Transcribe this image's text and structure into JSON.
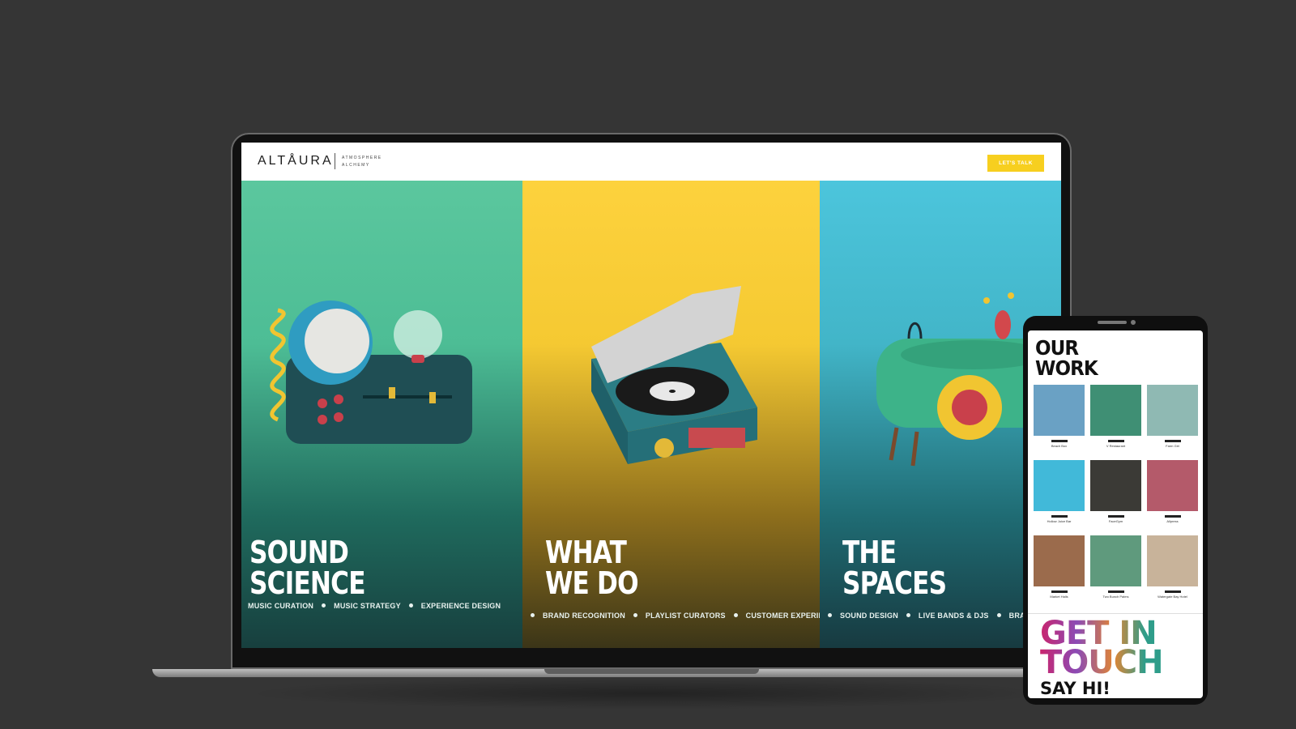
{
  "site": {
    "logo": "ALTÅURA",
    "tagline_line1": "ATMOSPHERE",
    "tagline_line2": "ALCHEMY",
    "cta_label": "LET'S TALK"
  },
  "panels": [
    {
      "title_line1": "SOUND",
      "title_line2": "SCIENCE",
      "tags": [
        "MUSIC CURATION",
        "MUSIC STRATEGY",
        "EXPERIENCE DESIGN"
      ]
    },
    {
      "title_line1": "WHAT",
      "title_line2": "WE DO",
      "tags": [
        "BRAND RECOGNITION",
        "PLAYLIST CURATORS",
        "CUSTOMER EXPERIE"
      ]
    },
    {
      "title_line1": "THE",
      "title_line2": "SPACES",
      "tags": [
        "SOUND DESIGN",
        "LIVE BANDS & DJS",
        "BRA"
      ]
    }
  ],
  "phone": {
    "heading_line1": "OUR",
    "heading_line2": "WORK",
    "work_items": [
      {
        "name": "Beach Box",
        "color": "#6aa1c4"
      },
      {
        "name": "V Restaurant",
        "color": "#3f8f74"
      },
      {
        "name": "Farm Girl",
        "color": "#8fb9b3"
      },
      {
        "name": "Hollow Juice Bar",
        "color": "#41b9d9"
      },
      {
        "name": "FaceGym",
        "color": "#3b3a36"
      },
      {
        "name": "Allpress",
        "color": "#b45a6a"
      },
      {
        "name": "Market Halls",
        "color": "#9b6b4c"
      },
      {
        "name": "Two Bunch Palms",
        "color": "#5f9a7d"
      },
      {
        "name": "Watergate Bay Hotel",
        "color": "#c8b39a"
      }
    ],
    "cta_line1": "GET IN",
    "cta_line2": "TOUCH",
    "cta_say": "SAY HI!"
  }
}
